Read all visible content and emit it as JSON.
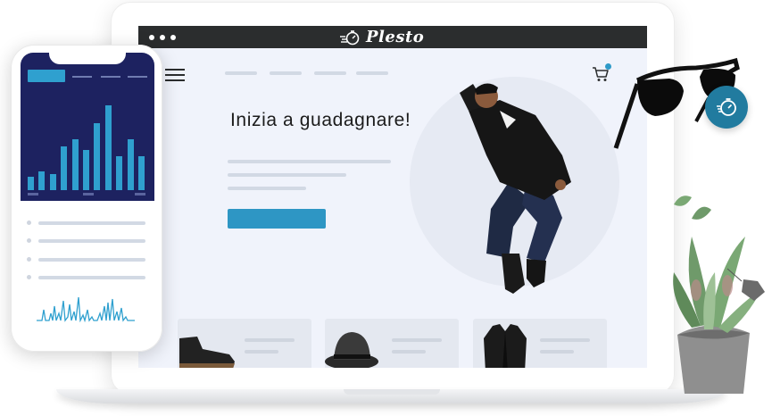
{
  "brand": {
    "name": "Plesto",
    "logo_icon": "stopwatch-icon"
  },
  "hero": {
    "headline": "Inizia a guadagnare!"
  },
  "colors": {
    "titlebar": "#2b2d2e",
    "accent": "#2e96c4",
    "badge": "#217b9f",
    "phone_chart_bg": "#1d2260",
    "bars": "#2fa0cf"
  },
  "phone_chart": {
    "type": "bar",
    "values": [
      14,
      19,
      16,
      45,
      52,
      41,
      68,
      86,
      35,
      52,
      35
    ]
  },
  "products": [
    {
      "name": "boots",
      "icon": "boot-icon"
    },
    {
      "name": "hat",
      "icon": "hat-icon"
    },
    {
      "name": "jacket",
      "icon": "jacket-icon"
    }
  ],
  "decorations": [
    "sunglasses",
    "succulent-plant",
    "price-tag",
    "jumping-man"
  ]
}
